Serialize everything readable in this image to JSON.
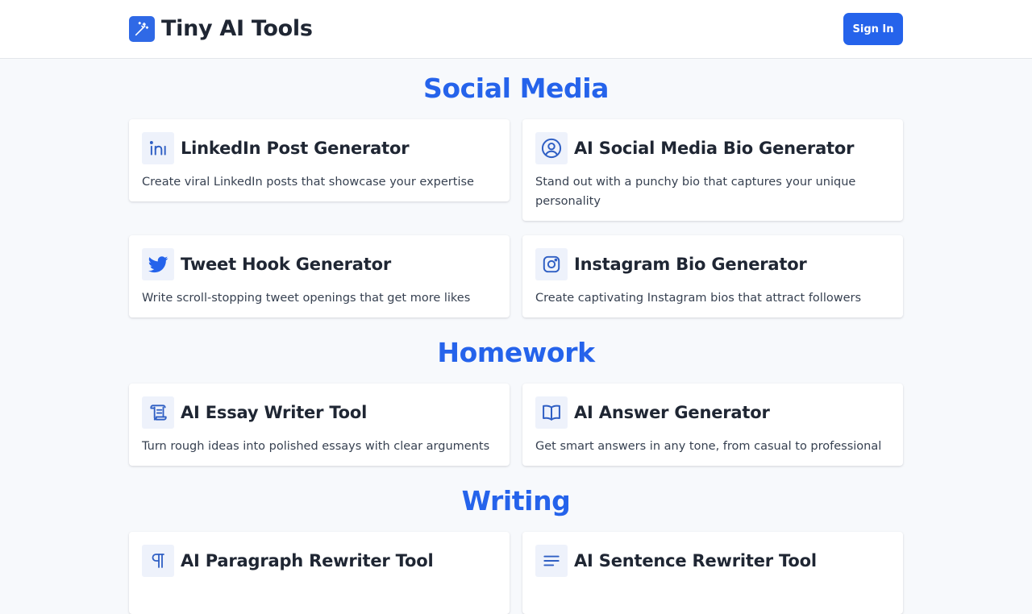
{
  "header": {
    "app_name": "Tiny AI Tools",
    "sign_in_label": "Sign In"
  },
  "sections": [
    {
      "title": "Social Media",
      "tools": [
        {
          "title": "LinkedIn Post Generator",
          "description": "Create viral LinkedIn posts that showcase your expertise",
          "icon": "linkedin-icon"
        },
        {
          "title": "AI Social Media Bio Generator",
          "description": "Stand out with a punchy bio that captures your unique personality",
          "icon": "user-circle-icon"
        },
        {
          "title": "Tweet Hook Generator",
          "description": "Write scroll-stopping tweet openings that get more likes",
          "icon": "twitter-icon"
        },
        {
          "title": "Instagram Bio Generator",
          "description": "Create captivating Instagram bios that attract followers",
          "icon": "instagram-icon"
        }
      ]
    },
    {
      "title": "Homework",
      "tools": [
        {
          "title": "AI Essay Writer Tool",
          "description": "Turn rough ideas into polished essays with clear arguments",
          "icon": "scroll-icon"
        },
        {
          "title": "AI Answer Generator",
          "description": "Get smart answers in any tone, from casual to professional",
          "icon": "open-book-icon"
        }
      ]
    },
    {
      "title": "Writing",
      "tools": [
        {
          "title": "AI Paragraph Rewriter Tool",
          "description": "",
          "icon": "pilcrow-icon"
        },
        {
          "title": "AI Sentence Rewriter Tool",
          "description": "",
          "icon": "text-lines-icon"
        }
      ]
    }
  ],
  "colors": {
    "accent": "#2563eb",
    "page_background": "#f7f9fc",
    "card_background": "#ffffff",
    "icon_tile": "#eef2fb",
    "text_dark": "#1f2633"
  }
}
